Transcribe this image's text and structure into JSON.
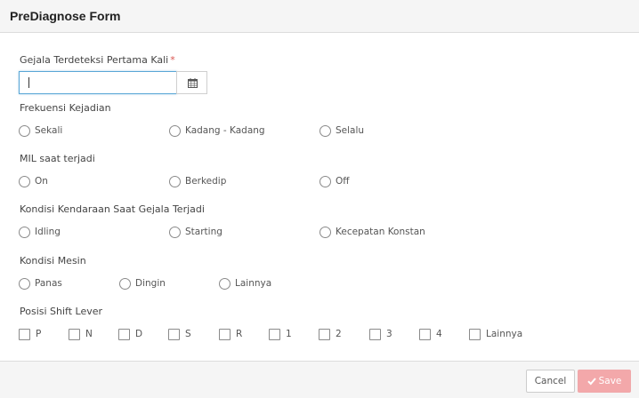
{
  "modal": {
    "title": "PreDiagnose Form",
    "cancel_label": "Cancel",
    "save_label": "Save"
  },
  "form": {
    "gejala": {
      "label": "Gejala Terdeteksi Pertama Kali",
      "required_mark": "*",
      "value": "",
      "calendar_icon": "calendar-icon"
    },
    "frekuensi": {
      "label": "Frekuensi Kejadian",
      "options": [
        "Sekali",
        "Kadang - Kadang",
        "Selalu"
      ]
    },
    "mil": {
      "label": "MIL saat terjadi",
      "options": [
        "On",
        "Berkedip",
        "Off"
      ]
    },
    "kondisi_kendaraan": {
      "label": "Kondisi Kendaraan Saat Gejala Terjadi",
      "options": [
        "Idling",
        "Starting",
        "Kecepatan Konstan"
      ]
    },
    "kondisi_mesin": {
      "label": "Kondisi Mesin",
      "options": [
        "Panas",
        "Dingin",
        "Lainnya"
      ]
    },
    "posisi_shift": {
      "label": "Posisi Shift Lever",
      "options": [
        "P",
        "N",
        "D",
        "S",
        "R",
        "1",
        "2",
        "3",
        "4",
        "Lainnya"
      ]
    }
  },
  "colors": {
    "save_button": "#f3a8aa",
    "input_focus_border": "#5aa7d6",
    "required": "#d9534f"
  }
}
